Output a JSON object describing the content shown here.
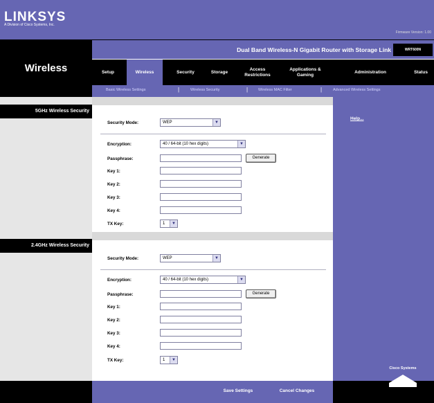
{
  "header": {
    "logo": "LINKSYS",
    "logo_subtitle": "A Division of Cisco Systems, Inc.",
    "firmware": "Firmware Version: 1.00"
  },
  "page_title": "Wireless",
  "product": {
    "name": "Dual Band Wireless-N Gigabit Router with Storage Link",
    "model": "WRT600N"
  },
  "tabs": [
    {
      "label": "Setup"
    },
    {
      "label": "Wireless"
    },
    {
      "label": "Security"
    },
    {
      "label": "Storage"
    },
    {
      "label": "Access Restrictions"
    },
    {
      "label": "Applications & Gaming"
    },
    {
      "label": "Administration"
    },
    {
      "label": "Status"
    }
  ],
  "subtabs": [
    {
      "label": "Basic Wireless Settings"
    },
    {
      "label": "Wireless Security"
    },
    {
      "label": "Wireless MAC Filter"
    },
    {
      "label": "Advanced Wireless Settings"
    }
  ],
  "sections": [
    {
      "heading": "5GHz Wireless Security",
      "security_mode_label": "Security Mode:",
      "security_mode_value": "WEP",
      "encryption_label": "Encryption:",
      "encryption_value": "40 / 64-bit (10 hex digits)",
      "passphrase_label": "Passphrase:",
      "generate_label": "Generate",
      "key1_label": "Key 1:",
      "key2_label": "Key 2:",
      "key3_label": "Key 3:",
      "key4_label": "Key 4:",
      "txkey_label": "TX Key:",
      "txkey_value": "1"
    },
    {
      "heading": "2.4GHz Wireless Security",
      "security_mode_label": "Security Mode:",
      "security_mode_value": "WEP",
      "encryption_label": "Encryption:",
      "encryption_value": "40 / 64-bit (10 hex digits)",
      "passphrase_label": "Passphrase:",
      "generate_label": "Generate",
      "key1_label": "Key 1:",
      "key2_label": "Key 2:",
      "key3_label": "Key 3:",
      "key4_label": "Key 4:",
      "txkey_label": "TX Key:",
      "txkey_value": "1"
    }
  ],
  "help": "Help...",
  "footer": {
    "save": "Save Settings",
    "cancel": "Cancel Changes"
  },
  "cisco": "Cisco Systems",
  "colors": {
    "brand_purple": "#6666b3",
    "black": "#000000"
  }
}
